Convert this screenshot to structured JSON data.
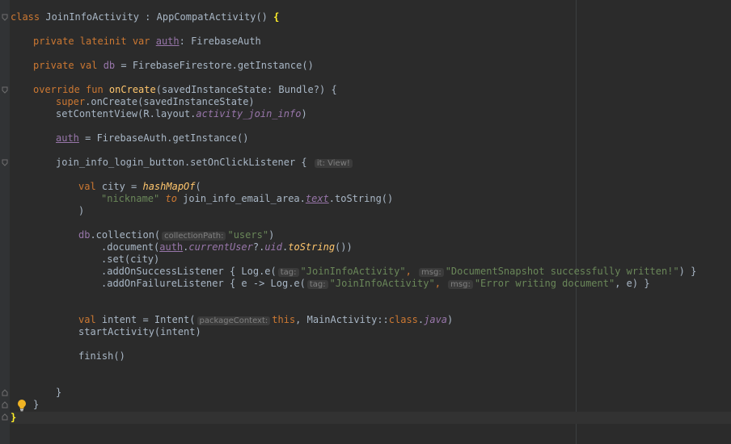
{
  "editor": {
    "language": "Kotlin",
    "theme_colors": {
      "background": "#2b2b2b",
      "gutter": "#313335",
      "keyword": "#cc7832",
      "function": "#ffc66d",
      "string": "#6a8759",
      "property": "#9876aa",
      "default": "#a9b7c6",
      "hint": "#808080",
      "matched_brace": "#ffef28"
    },
    "icons": [
      "fold-marker-icon",
      "intention-bulb-icon"
    ]
  },
  "code": {
    "l1": {
      "kw": "class ",
      "name": "JoinInfoActivity",
      "mid": " : AppCompatActivity() ",
      "brace": "{"
    },
    "l2": {
      "kw": "private lateinit var ",
      "prop": "auth",
      "rest": ": FirebaseAuth"
    },
    "l3": {
      "kw": "private val ",
      "prop": "db",
      "rest": " = FirebaseFirestore.getInstance()"
    },
    "l4": {
      "kw": "override fun ",
      "fn": "onCreate",
      "rest": "(savedInstanceState: Bundle?) {"
    },
    "l5": {
      "kw": "super",
      "rest": ".onCreate(savedInstanceState)"
    },
    "l6": {
      "pre": "setContentView(R.layout.",
      "prop": "activity_join_info",
      "post": ")"
    },
    "l7": {
      "prop": "auth",
      "rest": " = FirebaseAuth.getInstance()"
    },
    "l8": {
      "pre": "join_info_login_button.setOnClickListener { ",
      "hint": "it: View!"
    },
    "l9": {
      "kw": "val ",
      "pre": "city = ",
      "fn": "hashMapOf",
      "post": "("
    },
    "l10": {
      "str": "\"nickname\"",
      "kw": " to ",
      "pre": "join_info_email_area.",
      "prop": "text",
      "post": ".toString()"
    },
    "l11": {
      "text": ")"
    },
    "l12": {
      "prop": "db",
      "pre": ".collection(",
      "hint": "collectionPath:",
      "str": "\"users\"",
      "post": ")"
    },
    "l13": {
      "pre": ".document(",
      "prop1": "auth",
      "dot1": ".",
      "prop2": "currentUser",
      "q": "?.",
      "prop3": "uid",
      "dot2": ".",
      "fn": "toString",
      "post": "())"
    },
    "l14": {
      "text": ".set(city)"
    },
    "l15": {
      "pre": ".addOnSuccessListener { Log.e(",
      "hint1": "tag:",
      "str1": "\"JoinInfoActivity\"",
      "comma": ", ",
      "hint2": "msg:",
      "str2": "\"DocumentSnapshot successfully written!\"",
      "post": ") }"
    },
    "l16": {
      "pre": ".addOnFailureListener { e -> Log.e(",
      "hint1": "tag:",
      "str1": "\"JoinInfoActivity\"",
      "comma": ", ",
      "hint2": "msg:",
      "str2": "\"Error writing document\"",
      "post": ", e) }"
    },
    "l17": {
      "kw1": "val ",
      "pre": "intent = Intent(",
      "hint": "packageContext:",
      "kw2": "this",
      "mid": ", MainActivity::",
      "kw3": "class",
      "dot": ".",
      "prop": "java",
      "post": ")"
    },
    "l18": {
      "text": "startActivity(intent)"
    },
    "l19": {
      "text": "finish()"
    },
    "l20": {
      "text": "}"
    },
    "l21": {
      "text": "}"
    },
    "l22": {
      "text": "}"
    }
  }
}
